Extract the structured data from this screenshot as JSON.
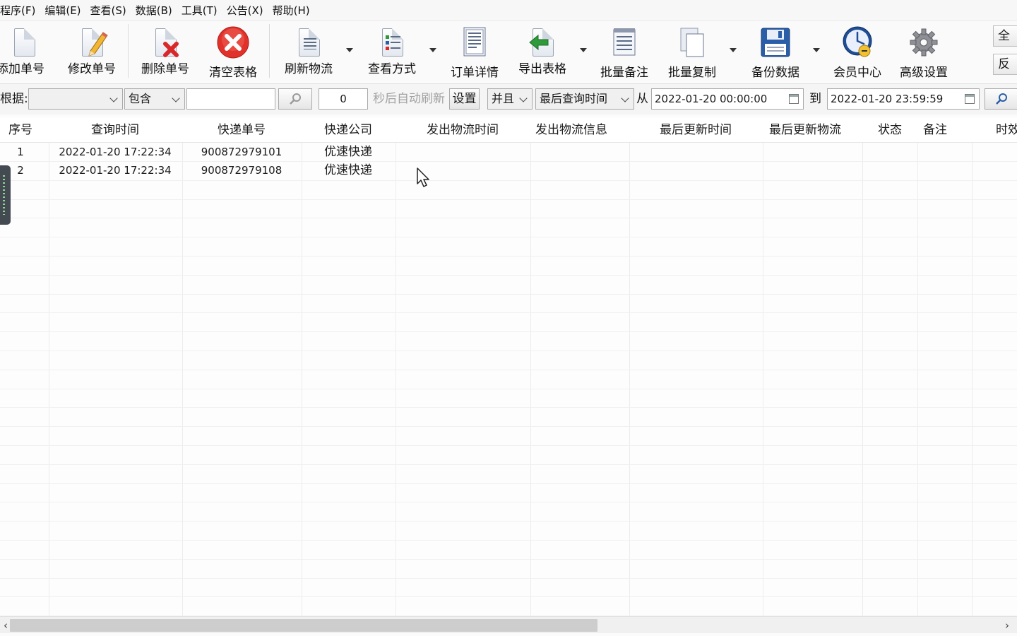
{
  "menu": [
    "程序(F)",
    "编辑(E)",
    "查看(S)",
    "数据(B)",
    "工具(T)",
    "公告(X)",
    "帮助(H)"
  ],
  "toolbar": {
    "add": "添加单号",
    "edit": "修改单号",
    "delete": "删除单号",
    "clear": "清空表格",
    "refresh": "刷新物流",
    "view_mode": "查看方式",
    "order_detail": "订单详情",
    "export": "导出表格",
    "batch_note": "批量备注",
    "batch_copy": "批量复制",
    "backup": "备份数据",
    "member": "会员中心",
    "advanced": "高级设置",
    "side_top": "全选",
    "side_bottom": "反选"
  },
  "filter": {
    "label": "根据:",
    "field_value": "",
    "op_value": "包含",
    "keyword_value": "",
    "seconds_value": "0",
    "auto_refresh_text": "秒后自动刷新",
    "set_button": "设置",
    "logic_value": "并且",
    "time_field_value": "最后查询时间",
    "from_label": "从",
    "from_value": "2022-01-20 00:00:00",
    "to_label": "到",
    "to_value": "2022-01-20 23:59:59"
  },
  "table": {
    "columns": [
      "序号",
      "查询时间",
      "快递单号",
      "快递公司",
      "发出物流时间",
      "发出物流信息",
      "最后更新时间",
      "最后更新物流",
      "状态",
      "备注",
      "时效"
    ],
    "rows": [
      [
        "1",
        "2022-01-20 17:22:34",
        "900872979101",
        "优速快递"
      ],
      [
        "2",
        "2022-01-20 17:22:34",
        "900872979108",
        "优速快递"
      ]
    ]
  },
  "colors": {
    "accent_red": "#e0322b",
    "accent_green": "#2e9a3a",
    "accent_blue": "#2a5ea8"
  }
}
